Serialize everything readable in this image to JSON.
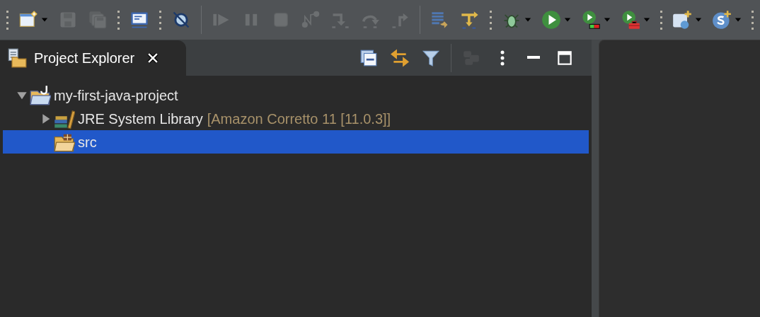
{
  "toolbar": {
    "items": [
      {
        "kind": "grip"
      },
      {
        "kind": "new",
        "disabled": false,
        "dropdown": true
      },
      {
        "kind": "save",
        "disabled": true,
        "dropdown": false
      },
      {
        "kind": "save-all",
        "disabled": true,
        "dropdown": false
      },
      {
        "kind": "grip"
      },
      {
        "kind": "console",
        "disabled": false,
        "dropdown": false
      },
      {
        "kind": "grip"
      },
      {
        "kind": "skip-breakpoints",
        "disabled": false,
        "dropdown": false
      },
      {
        "kind": "separator"
      },
      {
        "kind": "resume",
        "disabled": true,
        "dropdown": false
      },
      {
        "kind": "suspend",
        "disabled": true,
        "dropdown": false
      },
      {
        "kind": "terminate",
        "disabled": true,
        "dropdown": false
      },
      {
        "kind": "disconnect",
        "disabled": true,
        "dropdown": false
      },
      {
        "kind": "step-into",
        "disabled": true,
        "dropdown": false
      },
      {
        "kind": "step-over",
        "disabled": true,
        "dropdown": false
      },
      {
        "kind": "step-return",
        "disabled": true,
        "dropdown": false
      },
      {
        "kind": "separator"
      },
      {
        "kind": "drop-frame",
        "disabled": false,
        "dropdown": false
      },
      {
        "kind": "step-filters",
        "disabled": false,
        "dropdown": false
      },
      {
        "kind": "grip"
      },
      {
        "kind": "debug",
        "disabled": false,
        "dropdown": true
      },
      {
        "kind": "run",
        "disabled": false,
        "dropdown": true
      },
      {
        "kind": "coverage",
        "disabled": false,
        "dropdown": true
      },
      {
        "kind": "external-tools",
        "disabled": false,
        "dropdown": true
      },
      {
        "kind": "grip"
      },
      {
        "kind": "new-web",
        "disabled": false,
        "dropdown": true
      },
      {
        "kind": "new-server",
        "disabled": false,
        "dropdown": true
      },
      {
        "kind": "grip"
      }
    ]
  },
  "view": {
    "title": "Project Explorer",
    "selected": true,
    "actions": [
      {
        "kind": "collapse-all",
        "disabled": false
      },
      {
        "kind": "link-editor",
        "disabled": false
      },
      {
        "kind": "filter",
        "disabled": false
      },
      {
        "kind": "separator"
      },
      {
        "kind": "focus",
        "disabled": true
      },
      {
        "kind": "view-menu",
        "disabled": false
      },
      {
        "kind": "minimize",
        "disabled": false
      },
      {
        "kind": "maximize",
        "disabled": false
      }
    ],
    "tree": [
      {
        "kind": "project",
        "label": "my-first-java-project",
        "expanded": true,
        "selected": false,
        "children": [
          {
            "kind": "library",
            "label": "JRE System Library",
            "decoration": "[Amazon Corretto 11 [11.0.3]]",
            "expanded": false,
            "selected": false
          },
          {
            "kind": "source-folder",
            "label": "src",
            "selected": true
          }
        ]
      }
    ]
  }
}
